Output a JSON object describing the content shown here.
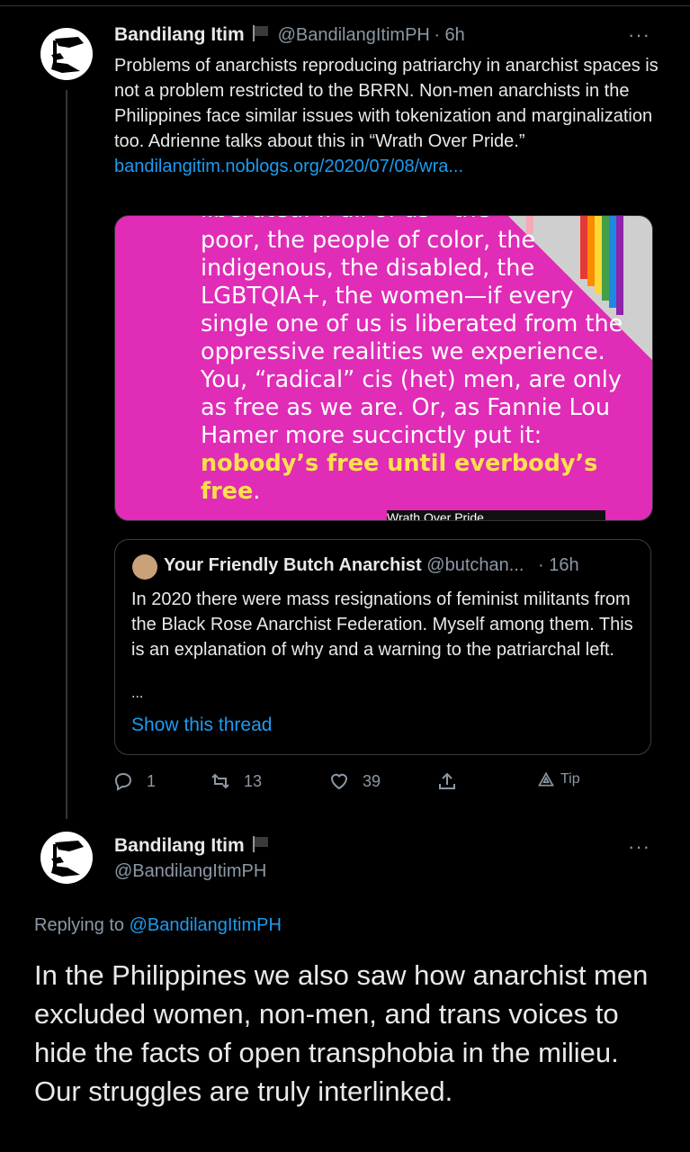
{
  "tweet1": {
    "name": "Bandilang Itim",
    "handle": "@BandilangItimPH",
    "time": "· 6h",
    "more": "···",
    "text": "Problems of anarchists reproducing patriarchy in anarchist spaces is not a problem restricted to the BRRN. Non-men anarchists in the Philippines face similar issues with tokenization and marginalization too. Adrienne talks about this in “Wrath Over Pride.”",
    "link": "bandilangitim.noblogs.org/2020/07/08/wra...",
    "media": {
      "line_top": "liberated. If all of us—the",
      "text_plain": "poor, the people of color, the indigenous, the disabled, the LGBTQIA+, the women—if every single one of us is liberated from the oppressive realities we experience. You, “radical” cis (het) men, are only as free as we are. Or, as Fannie Lou Hamer more succinctly put it: ",
      "text_highlight": "nobody’s free until everbody’s free",
      "text_end": ".",
      "caption": "Wrath Over Pride",
      "background": "#e02cb6"
    },
    "quote": {
      "name": "Your Friendly Butch Anarchist",
      "handle": "@butchan...",
      "time": "· 16h",
      "text": "In 2020 there were mass resignations of feminist militants from the Black Rose Anarchist Federation. Myself among them. This is an explanation of why and a warning to the patriarchal left.",
      "ellipsis": "...",
      "show_thread": "Show this thread"
    },
    "actions": {
      "reply_count": "1",
      "retweet_count": "13",
      "like_count": "39",
      "tip_label": "Tip"
    }
  },
  "tweet2": {
    "name": "Bandilang Itim",
    "handle": "@BandilangItimPH",
    "more": "···",
    "replying_prefix": "Replying to ",
    "replying_handle": "@BandilangItimPH",
    "text": "In the Philippines we also saw how anarchist men excluded women, non-men, and trans voices to hide the facts of open transphobia in the milieu. Our struggles are truly interlinked."
  },
  "colors": {
    "background": "#000000",
    "link": "#1d9bf0",
    "secondary": "#8b98a5"
  }
}
